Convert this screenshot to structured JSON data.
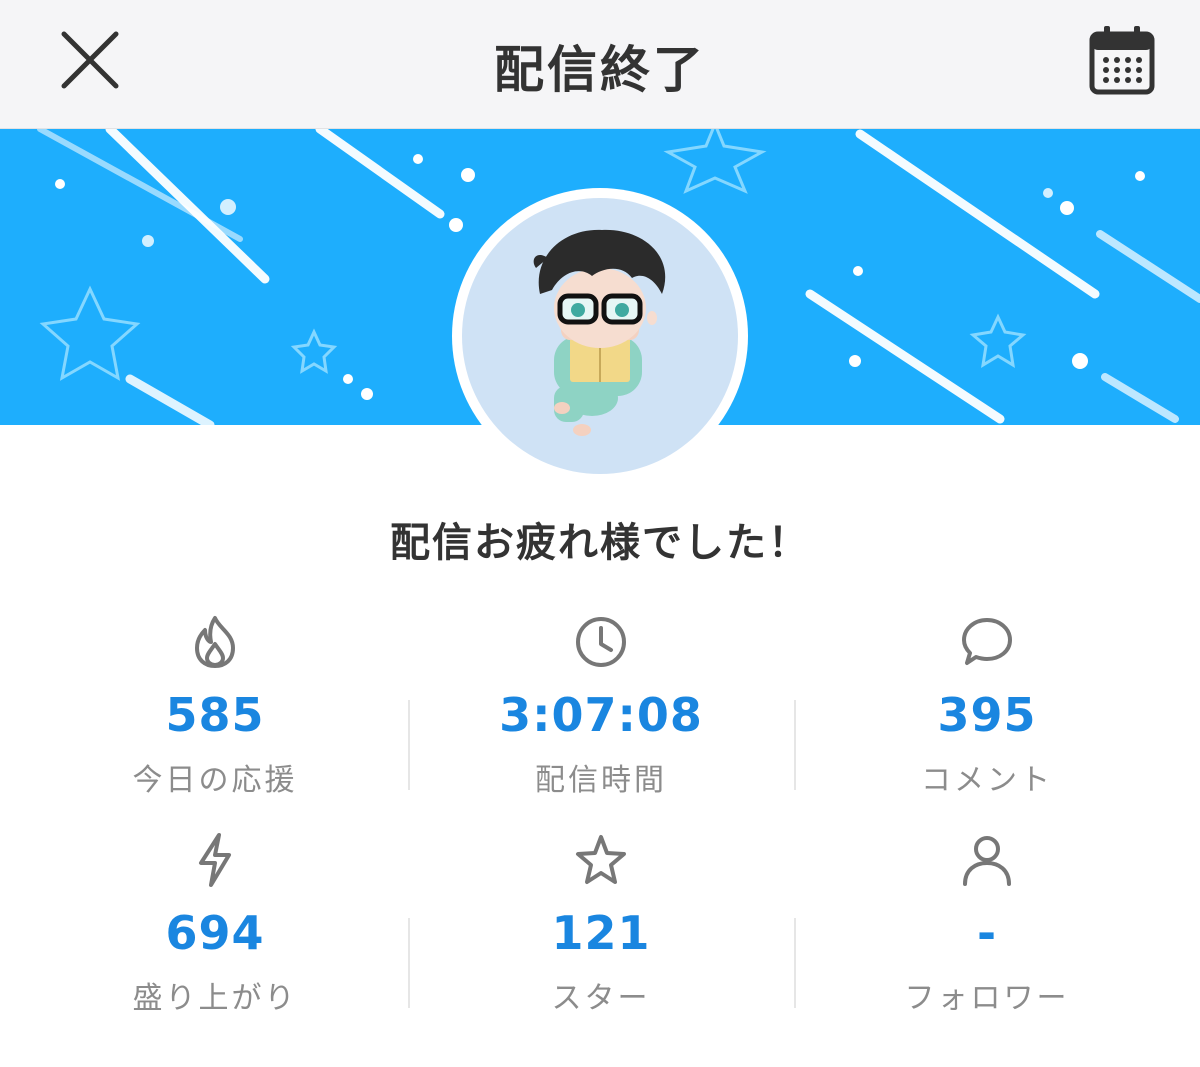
{
  "header": {
    "title": "配信終了",
    "close_icon": "close-icon",
    "calendar_icon": "calendar-icon"
  },
  "colors": {
    "accent": "#1a86e0",
    "banner": "#1eaefd",
    "label": "#8c8c8c",
    "title_text": "#333333"
  },
  "avatar": {
    "icon": "avatar-illustration"
  },
  "message": "配信お疲れ様でした！",
  "stats": [
    {
      "icon": "flame-icon",
      "value": "585",
      "label": "今日の応援"
    },
    {
      "icon": "clock-icon",
      "value": "3:07:08",
      "label": "配信時間"
    },
    {
      "icon": "comment-icon",
      "value": "395",
      "label": "コメント"
    },
    {
      "icon": "lightning-icon",
      "value": "694",
      "label": "盛り上がり"
    },
    {
      "icon": "star-icon",
      "value": "121",
      "label": "スター"
    },
    {
      "icon": "person-icon",
      "value": "-",
      "label": "フォロワー"
    }
  ]
}
